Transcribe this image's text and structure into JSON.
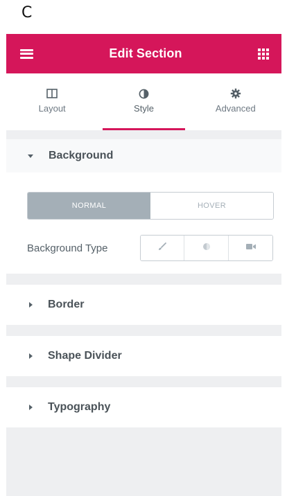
{
  "corner": {
    "letter": "C"
  },
  "header": {
    "title": "Edit Section",
    "menu_icon": "hamburger-icon",
    "widgets_icon": "grid-icon",
    "color": "#d5165a"
  },
  "tabs": [
    {
      "label": "Layout",
      "icon": "columns-icon",
      "active": false
    },
    {
      "label": "Style",
      "icon": "half-circle-icon",
      "active": true
    },
    {
      "label": "Advanced",
      "icon": "gear-icon",
      "active": false
    }
  ],
  "sections": {
    "background": {
      "title": "Background",
      "expanded": true,
      "switcher": {
        "normal": "NORMAL",
        "hover": "HOVER",
        "active": "NORMAL"
      },
      "type_label": "Background Type",
      "type_options": [
        "brush-icon",
        "gradient-icon",
        "video-icon"
      ]
    },
    "border": {
      "title": "Border"
    },
    "shape_divider": {
      "title": "Shape Divider"
    },
    "typography": {
      "title": "Typography"
    }
  }
}
